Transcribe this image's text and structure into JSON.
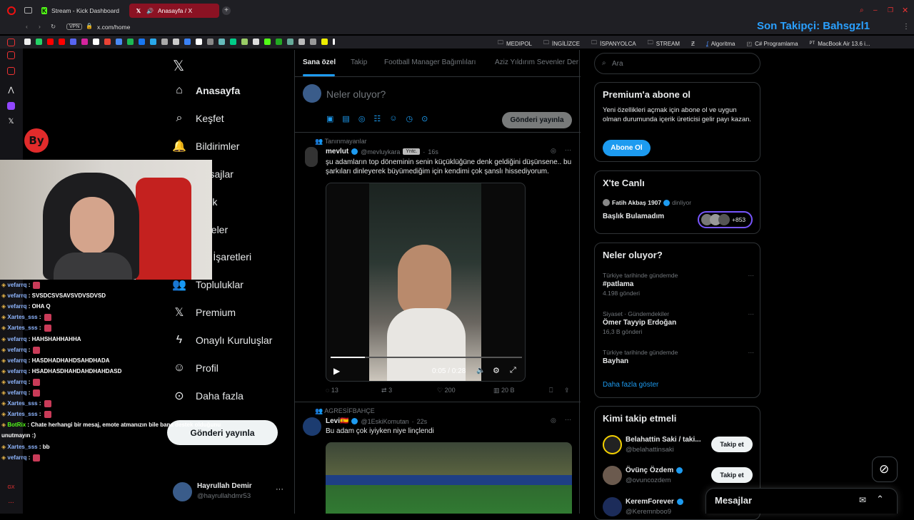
{
  "browser": {
    "tabs": [
      {
        "label": "Stream - Kick Dashboard",
        "icon": "kick-icon"
      },
      {
        "label": "Anasayfa / X",
        "icon": "x-icon"
      }
    ],
    "url": "x.com/home",
    "vpn_label": "VPN",
    "bookmarks": [
      "MEDIPOL",
      "İNGİLİZCE",
      "İSPANYOLCA",
      "STREAM",
      "Algoritma",
      "C# Programlama",
      "MacBook Air 13.6 i..."
    ],
    "stream_overlay": "Son Takipçi: Bahsgzl1"
  },
  "nav": {
    "items": [
      {
        "label": "Anasayfa",
        "icon": "home-icon"
      },
      {
        "label": "Keşfet",
        "icon": "search-icon"
      },
      {
        "label": "Bildirimler",
        "icon": "bell-icon"
      },
      {
        "label": "Mesajlar",
        "icon": "mail-icon"
      },
      {
        "label": "Grok",
        "icon": "grok-icon"
      },
      {
        "label": "Listeler",
        "icon": "list-icon"
      },
      {
        "label": "Yer İşaretleri",
        "icon": "bookmark-icon"
      },
      {
        "label": "Topluluklar",
        "icon": "people-icon"
      },
      {
        "label": "Premium",
        "icon": "x-icon"
      },
      {
        "label": "Onaylı Kuruluşlar",
        "icon": "bolt-icon"
      },
      {
        "label": "Profil",
        "icon": "person-icon"
      },
      {
        "label": "Daha fazla",
        "icon": "more-circle-icon"
      }
    ],
    "post_button": "Gönderi yayınla",
    "account": {
      "name": "Hayrullah Demir",
      "handle": "@hayrullahdmr53"
    }
  },
  "main": {
    "tabs": [
      "Sana özel",
      "Takip",
      "Football Manager Bağımlıları",
      "Aziz Yıldırım Sevenler Der"
    ],
    "compose_placeholder": "Neler oluyor?",
    "compose_button": "Gönderi yayınla",
    "tweets": [
      {
        "context": "Tanınmayanlar",
        "name": "mevlut",
        "handle": "@mevluykara",
        "badge": "Yntc.",
        "time": "16s",
        "text": "şu adamların top döneminin senin küçüklüğüne denk geldiğini düşünsene.. bu şarkıları dinleyerek büyümediğim için kendimi çok şanslı hissediyorum.",
        "video_time": "0:05 / 0:28",
        "video_progress": 0.18,
        "replies": "13",
        "reposts": "3",
        "likes": "200",
        "views": "20 B"
      },
      {
        "context": "AGRESİFBAHÇE",
        "name": "Levi🇪🇸",
        "handle": "@1EskiKomutan",
        "time": "22s",
        "text": "Bu adam çok iyiyken niye linçlendi"
      }
    ]
  },
  "right": {
    "search_placeholder": "Ara",
    "premium": {
      "title": "Premium'a abone ol",
      "text": "Yeni özellikleri açmak için abone ol ve uygun olman durumunda içerik üreticisi gelir payı kazan.",
      "button": "Abone Ol"
    },
    "live": {
      "title": "X'te Canlı",
      "host": "Fatih Akbaş 1907",
      "status": "dinliyor",
      "space_title": "Başlık Bulamadım",
      "listeners": "+853"
    },
    "trends": {
      "title": "Neler oluyor?",
      "items": [
        {
          "meta": "Türkiye tarihinde gündemde",
          "name": "#patlama",
          "count": "4.198 gönderi"
        },
        {
          "meta": "Siyaset · Gündemdekiler",
          "name": "Ömer Tayyip Erdoğan",
          "count": "16,3 B gönderi"
        },
        {
          "meta": "Türkiye tarihinde gündemde",
          "name": "Bayhan",
          "count": ""
        }
      ],
      "show_more": "Daha fazla göster"
    },
    "who_to_follow": {
      "title": "Kimi takip etmeli",
      "items": [
        {
          "name": "Belahattin Saki / taki...",
          "handle": "@belahattinsaki",
          "button": "Takip et"
        },
        {
          "name": "Övünç Özdem",
          "handle": "@ovuncozdem",
          "button": "Takip et"
        },
        {
          "name": "KeremForever",
          "handle": "@Keremnboo9",
          "button": ""
        }
      ]
    },
    "messages_title": "Mesajlar"
  },
  "chat": [
    {
      "user": "vefarrq",
      "msg": ":",
      "emote": true
    },
    {
      "user": "vefarrq",
      "msg": ": SVSDCSVSAVSVDVSDVSD"
    },
    {
      "user": "vefarrq",
      "msg": ": OHA Q"
    },
    {
      "user": "Xartes_sss",
      "msg": ":",
      "emote": true
    },
    {
      "user": "Xartes_sss",
      "msg": ":",
      "emote": true
    },
    {
      "user": "vefarrq",
      "msg": ": HAHSHAHHAHHA"
    },
    {
      "user": "vefarrq",
      "msg": ":",
      "emote": true
    },
    {
      "user": "vefarrq",
      "msg": ": HASDHADHAHDSAHDHADA"
    },
    {
      "user": "vefarrq",
      "msg": ": HSADHASDHAHDAHDHAHDASD"
    },
    {
      "user": "vefarrq",
      "msg": ":",
      "emote": true
    },
    {
      "user": "vefarrq",
      "msg": ":",
      "emote": true
    },
    {
      "user": "Xartes_sss",
      "msg": ":",
      "emote": true
    },
    {
      "user": "Xartes_sss",
      "msg": ":",
      "emote": true
    },
    {
      "user": "BotRix",
      "msg": ": Chate herhangi bir mesaj, emote atmanızın bile bana destek olduğunu"
    },
    {
      "user": "",
      "msg": "unutmayın :)"
    },
    {
      "user": "Xartes_sss",
      "msg": ": bb"
    },
    {
      "user": "vefarrq",
      "msg": ":",
      "emote": true
    }
  ],
  "colors": {
    "accent": "#1d9bf0",
    "tab_active": "#8b1223",
    "overlay": "#2aa0ff"
  }
}
